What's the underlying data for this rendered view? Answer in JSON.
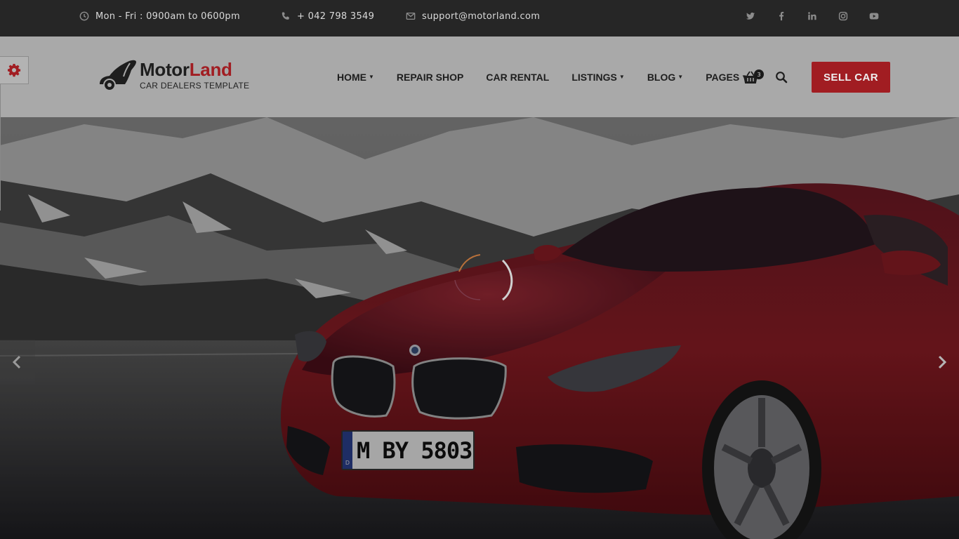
{
  "topbar": {
    "hours": "Mon - Fri : 0900am to 0600pm",
    "phone": "+ 042 798 3549",
    "email": "support@motorland.com",
    "socials": [
      "twitter-icon",
      "facebook-icon",
      "linkedin-icon",
      "instagram-icon",
      "youtube-icon"
    ]
  },
  "header": {
    "logo": {
      "part1": "Motor",
      "part2": "Land",
      "tagline": "CAR DEALERS TEMPLATE"
    },
    "nav": [
      {
        "label": "HOME",
        "dropdown": true
      },
      {
        "label": "REPAIR SHOP",
        "dropdown": false
      },
      {
        "label": "CAR RENTAL",
        "dropdown": false
      },
      {
        "label": "LISTINGS",
        "dropdown": true
      },
      {
        "label": "BLOG",
        "dropdown": true
      },
      {
        "label": "PAGES",
        "dropdown": true
      }
    ],
    "cart_count": "3",
    "sell_button": "SELL CAR"
  },
  "hero": {
    "plate": "M BY 5803",
    "plate_country": "D"
  },
  "colors": {
    "accent": "#a11d22",
    "topbar": "#262626",
    "header": "#a9a9a9"
  }
}
